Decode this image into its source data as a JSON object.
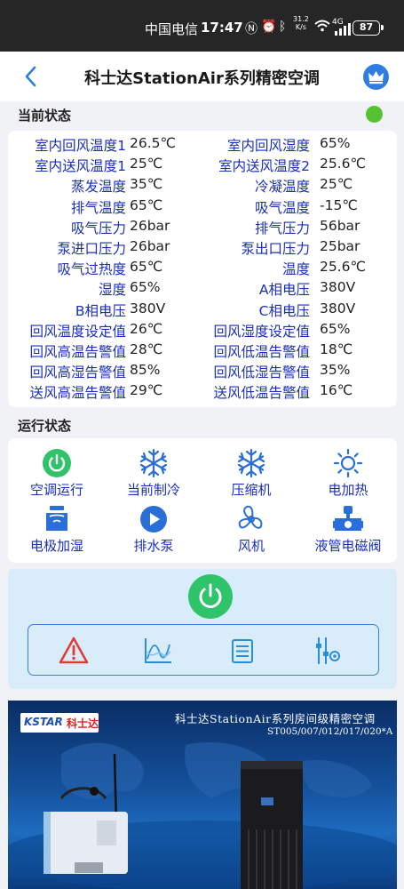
{
  "status_bar": {
    "carrier": "中国电信",
    "time": "17:47",
    "net_speed_value": "31.2",
    "net_speed_unit": "K/s",
    "network": "4G",
    "battery": "87"
  },
  "header": {
    "title": "科士达StationAir系列精密空调",
    "back_icon": "chevron-left-icon",
    "crown_icon": "crown-icon"
  },
  "current_status": {
    "title": "当前状态",
    "indicator_color": "#55c232",
    "rows": [
      {
        "l1": "室内回风温度1",
        "v1": "26.5℃",
        "l2": "室内回风湿度",
        "v2": "65%"
      },
      {
        "l1": "室内送风温度1",
        "v1": "25℃",
        "l2": "室内送风温度2",
        "v2": "25.6℃"
      },
      {
        "l1": "蒸发温度",
        "v1": "35℃",
        "l2": "冷凝温度",
        "v2": "25℃"
      },
      {
        "l1": "排气温度",
        "v1": "65℃",
        "l2": "吸气温度",
        "v2": "-15℃"
      },
      {
        "l1": "吸气压力",
        "v1": "26bar",
        "l2": "排气压力",
        "v2": "56bar"
      },
      {
        "l1": "泵进口压力",
        "v1": "26bar",
        "l2": "泵出口压力",
        "v2": "25bar"
      },
      {
        "l1": "吸气过热度",
        "v1": "65℃",
        "l2": "温度",
        "v2": "25.6℃"
      },
      {
        "l1": "湿度",
        "v1": "65%",
        "l2": "A相电压",
        "v2": "380V"
      },
      {
        "l1": "B相电压",
        "v1": "380V",
        "l2": "C相电压",
        "v2": "380V"
      },
      {
        "l1": "回风温度设定值",
        "v1": "26℃",
        "l2": "回风湿度设定值",
        "v2": "65%"
      },
      {
        "l1": "回风高温告警值",
        "v1": "28℃",
        "l2": "回风低温告警值",
        "v2": "18℃"
      },
      {
        "l1": "回风高湿告警值",
        "v1": "85%",
        "l2": "回风低湿告警值",
        "v2": "35%"
      },
      {
        "l1": "送风高温告警值",
        "v1": "29℃",
        "l2": "送风低温告警值",
        "v2": "16℃"
      }
    ]
  },
  "run_status": {
    "title": "运行状态",
    "items": [
      {
        "label": "空调运行",
        "icon": "power-icon",
        "color": "#2fc46a"
      },
      {
        "label": "当前制冷",
        "icon": "snowflake-icon",
        "color": "#2a6fd8"
      },
      {
        "label": "压缩机",
        "icon": "snowflake-icon",
        "color": "#2a6fd8"
      },
      {
        "label": "电加热",
        "icon": "sun-icon",
        "color": "#2a6fd8"
      },
      {
        "label": "电极加湿",
        "icon": "humidifier-icon",
        "color": "#2a6fd8"
      },
      {
        "label": "排水泵",
        "icon": "play-icon",
        "color": "#2a6fd8"
      },
      {
        "label": "风机",
        "icon": "fan-icon",
        "color": "#2a6fd8"
      },
      {
        "label": "液管电磁阀",
        "icon": "valve-icon",
        "color": "#2a6fd8"
      }
    ]
  },
  "controls": {
    "power_icon": "power-icon",
    "tools": [
      {
        "icon": "alarm-icon",
        "color": "#e23b3b"
      },
      {
        "icon": "curve-chart-icon",
        "color": "#2a8fd8"
      },
      {
        "icon": "list-icon",
        "color": "#2a8fd8"
      },
      {
        "icon": "settings-sliders-icon",
        "color": "#2a8fd8"
      }
    ]
  },
  "banner": {
    "logo_brand": "KSTAR",
    "logo_cn": "科士达",
    "title": "科士达StationAir系列房间级精密空调",
    "models": "ST005/007/012/017/020*A"
  }
}
